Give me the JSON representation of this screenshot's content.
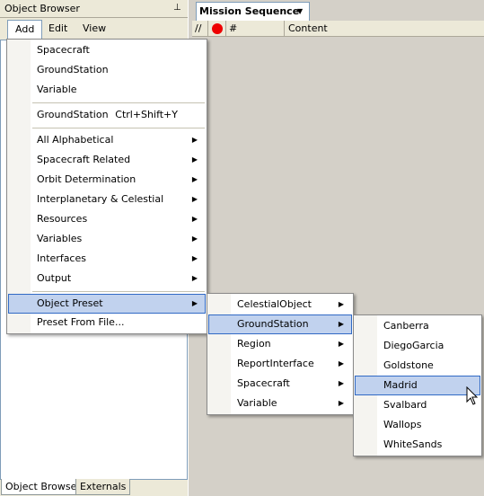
{
  "object_browser": {
    "title": "Object Browser",
    "menu": [
      "Add",
      "Edit",
      "View"
    ],
    "bottom_tabs": [
      "Object Browser",
      "Externals"
    ]
  },
  "mission_sequence": {
    "tab_label": "Mission Sequence",
    "columns": [
      "//",
      "#",
      "Content"
    ]
  },
  "add_menu": {
    "group1": [
      "Spacecraft",
      "GroundStation",
      "Variable"
    ],
    "shortcut_item": {
      "label": "GroundStation",
      "shortcut": "Ctrl+Shift+Y"
    },
    "submenus": [
      "All Alphabetical",
      "Spacecraft Related",
      "Orbit Determination",
      "Interplanetary & Celestial",
      "Resources",
      "Variables",
      "Interfaces",
      "Output"
    ],
    "object_preset": "Object Preset",
    "preset_from_file": "Preset From File..."
  },
  "preset_menu": {
    "items": [
      "CelestialObject",
      "GroundStation",
      "Region",
      "ReportInterface",
      "Spacecraft",
      "Variable"
    ],
    "highlighted": "GroundStation"
  },
  "groundstation_menu": {
    "items": [
      "Canberra",
      "DiegoGarcia",
      "Goldstone",
      "Madrid",
      "Svalbard",
      "Wallops",
      "WhiteSands"
    ],
    "highlighted": "Madrid"
  },
  "colors": {
    "highlight_bg": "#c1d2ee",
    "highlight_border": "#316ac5",
    "record_dot": "#e00000"
  }
}
